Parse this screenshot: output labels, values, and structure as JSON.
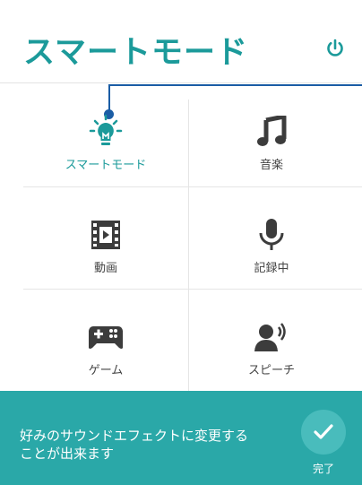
{
  "header": {
    "title": "スマートモード"
  },
  "grid": [
    {
      "label": "スマートモード",
      "icon": "lightbulb-icon",
      "active": true
    },
    {
      "label": "音楽",
      "icon": "music-note-icon",
      "active": false
    },
    {
      "label": "動画",
      "icon": "film-icon",
      "active": false
    },
    {
      "label": "記録中",
      "icon": "microphone-icon",
      "active": false
    },
    {
      "label": "ゲーム",
      "icon": "gamepad-icon",
      "active": false
    },
    {
      "label": "スピーチ",
      "icon": "speech-icon",
      "active": false
    }
  ],
  "footer": {
    "message_line1": "好みのサウンドエフェクトに変更する",
    "message_line2": "ことが出来ます",
    "done_label": "完了"
  },
  "colors": {
    "accent": "#1b9a9a",
    "footer_bg": "#2aa8a8",
    "callout": "#1b5da5"
  }
}
